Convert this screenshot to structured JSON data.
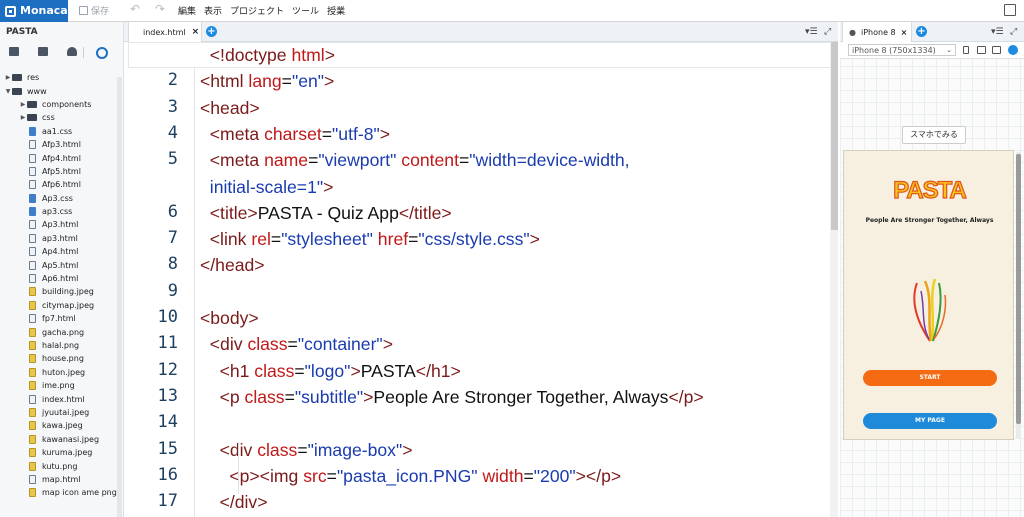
{
  "app": {
    "name": "Monaca",
    "save_label": "保存"
  },
  "menu": [
    "編集",
    "表示",
    "プロジェクト",
    "ツール",
    "授業"
  ],
  "sidebar": {
    "project": "PASTA",
    "tree": [
      {
        "label": "res",
        "type": "folder",
        "depth": 0,
        "arrow": "▶"
      },
      {
        "label": "www",
        "type": "folder",
        "depth": 0,
        "arrow": "▼"
      },
      {
        "label": "components",
        "type": "folder",
        "depth": 1,
        "arrow": "▶"
      },
      {
        "label": "css",
        "type": "folder",
        "depth": 1,
        "arrow": "▶"
      },
      {
        "label": "aa1.css",
        "type": "css",
        "depth": 1
      },
      {
        "label": "Afp3.html",
        "type": "file",
        "depth": 1
      },
      {
        "label": "Afp4.html",
        "type": "file",
        "depth": 1
      },
      {
        "label": "Afp5.html",
        "type": "file",
        "depth": 1
      },
      {
        "label": "Afp6.html",
        "type": "file",
        "depth": 1
      },
      {
        "label": "Ap3.css",
        "type": "css",
        "depth": 1
      },
      {
        "label": "ap3.css",
        "type": "css",
        "depth": 1
      },
      {
        "label": "Ap3.html",
        "type": "file",
        "depth": 1
      },
      {
        "label": "ap3.html",
        "type": "file",
        "depth": 1
      },
      {
        "label": "Ap4.html",
        "type": "file",
        "depth": 1
      },
      {
        "label": "Ap5.html",
        "type": "file",
        "depth": 1
      },
      {
        "label": "Ap6.html",
        "type": "file",
        "depth": 1
      },
      {
        "label": "building.jpeg",
        "type": "img",
        "depth": 1
      },
      {
        "label": "citymap.jpeg",
        "type": "img",
        "depth": 1
      },
      {
        "label": "fp7.html",
        "type": "file",
        "depth": 1
      },
      {
        "label": "gacha.png",
        "type": "img",
        "depth": 1
      },
      {
        "label": "halal.png",
        "type": "img",
        "depth": 1
      },
      {
        "label": "house.png",
        "type": "img",
        "depth": 1
      },
      {
        "label": "huton.jpeg",
        "type": "img",
        "depth": 1
      },
      {
        "label": "ime.png",
        "type": "img",
        "depth": 1
      },
      {
        "label": "index.html",
        "type": "file",
        "depth": 1
      },
      {
        "label": "jyuutai.jpeg",
        "type": "img",
        "depth": 1
      },
      {
        "label": "kawa.jpeg",
        "type": "img",
        "depth": 1
      },
      {
        "label": "kawanasi.jpeg",
        "type": "img",
        "depth": 1
      },
      {
        "label": "kuruma.jpeg",
        "type": "img",
        "depth": 1
      },
      {
        "label": "kutu.png",
        "type": "img",
        "depth": 1
      },
      {
        "label": "map.html",
        "type": "file",
        "depth": 1
      },
      {
        "label": "map icon ame png",
        "type": "img",
        "depth": 1
      }
    ]
  },
  "editor": {
    "tab_label": "index.html",
    "close_glyph": "×",
    "lines": [
      {
        "n": "1",
        "parts": [
          [
            "tx",
            "  "
          ],
          [
            "kt",
            "<!doctype "
          ],
          [
            "at",
            "html"
          ],
          [
            "kt",
            ">"
          ]
        ]
      },
      {
        "n": "2",
        "parts": [
          [
            "kt",
            "<html "
          ],
          [
            "at",
            "lang"
          ],
          [
            "tx",
            "="
          ],
          [
            "sv",
            "\"en\""
          ],
          [
            "kt",
            ">"
          ]
        ]
      },
      {
        "n": "3",
        "parts": [
          [
            "kt",
            "<head>"
          ]
        ]
      },
      {
        "n": "4",
        "parts": [
          [
            "tx",
            "  "
          ],
          [
            "kt",
            "<meta "
          ],
          [
            "at",
            "charset"
          ],
          [
            "tx",
            "="
          ],
          [
            "sv",
            "\"utf-8\""
          ],
          [
            "kt",
            ">"
          ]
        ]
      },
      {
        "n": "5",
        "parts": [
          [
            "tx",
            "  "
          ],
          [
            "kt",
            "<meta "
          ],
          [
            "at",
            "name"
          ],
          [
            "tx",
            "="
          ],
          [
            "sv",
            "\"viewport\""
          ],
          [
            "tx",
            " "
          ],
          [
            "at",
            "content"
          ],
          [
            "tx",
            "="
          ],
          [
            "sv",
            "\"width=device-width,"
          ]
        ]
      },
      {
        "n": "",
        "parts": [
          [
            "tx",
            "  "
          ],
          [
            "sv",
            "initial-scale=1\""
          ],
          [
            "kt",
            ">"
          ]
        ]
      },
      {
        "n": "6",
        "parts": [
          [
            "tx",
            "  "
          ],
          [
            "kt",
            "<title>"
          ],
          [
            "tx",
            "PASTA - Quiz App"
          ],
          [
            "kt",
            "</title>"
          ]
        ]
      },
      {
        "n": "7",
        "parts": [
          [
            "tx",
            "  "
          ],
          [
            "kt",
            "<link "
          ],
          [
            "at",
            "rel"
          ],
          [
            "tx",
            "="
          ],
          [
            "sv",
            "\"stylesheet\""
          ],
          [
            "tx",
            " "
          ],
          [
            "at",
            "href"
          ],
          [
            "tx",
            "="
          ],
          [
            "sv",
            "\"css/style.css\""
          ],
          [
            "kt",
            ">"
          ]
        ]
      },
      {
        "n": "8",
        "parts": [
          [
            "kt",
            "</head>"
          ]
        ]
      },
      {
        "n": "9",
        "parts": []
      },
      {
        "n": "10",
        "parts": [
          [
            "kt",
            "<body>"
          ]
        ]
      },
      {
        "n": "11",
        "parts": [
          [
            "tx",
            "  "
          ],
          [
            "kt",
            "<div "
          ],
          [
            "at",
            "class"
          ],
          [
            "tx",
            "="
          ],
          [
            "sv",
            "\"container\""
          ],
          [
            "kt",
            ">"
          ]
        ]
      },
      {
        "n": "12",
        "parts": [
          [
            "tx",
            "    "
          ],
          [
            "kt",
            "<h1 "
          ],
          [
            "at",
            "class"
          ],
          [
            "tx",
            "="
          ],
          [
            "sv",
            "\"logo\""
          ],
          [
            "kt",
            ">"
          ],
          [
            "tx",
            "PASTA"
          ],
          [
            "kt",
            "</h1>"
          ]
        ]
      },
      {
        "n": "13",
        "parts": [
          [
            "tx",
            "    "
          ],
          [
            "kt",
            "<p "
          ],
          [
            "at",
            "class"
          ],
          [
            "tx",
            "="
          ],
          [
            "sv",
            "\"subtitle\""
          ],
          [
            "kt",
            ">"
          ],
          [
            "tx",
            "People Are Stronger Together, Always"
          ],
          [
            "kt",
            "</p>"
          ]
        ]
      },
      {
        "n": "14",
        "parts": []
      },
      {
        "n": "15",
        "parts": [
          [
            "tx",
            "    "
          ],
          [
            "kt",
            "<div "
          ],
          [
            "at",
            "class"
          ],
          [
            "tx",
            "="
          ],
          [
            "sv",
            "\"image-box\""
          ],
          [
            "kt",
            ">"
          ]
        ]
      },
      {
        "n": "16",
        "parts": [
          [
            "tx",
            "      "
          ],
          [
            "kt",
            "<p><img "
          ],
          [
            "at",
            "src"
          ],
          [
            "tx",
            "="
          ],
          [
            "sv",
            "\"pasta_icon.PNG\""
          ],
          [
            "tx",
            " "
          ],
          [
            "at",
            "width"
          ],
          [
            "tx",
            "="
          ],
          [
            "sv",
            "\"200\""
          ],
          [
            "kt",
            "></p>"
          ]
        ]
      },
      {
        "n": "17",
        "parts": [
          [
            "tx",
            "    "
          ],
          [
            "kt",
            "</div>"
          ]
        ]
      }
    ]
  },
  "preview": {
    "tab_label": "iPhone 8",
    "device_select": "iPhone 8 (750x1334)",
    "smartphone_button": "スマホでみる",
    "phone": {
      "title": "PASTA",
      "subtitle": "People Are Stronger Together, Always",
      "start_label": "START",
      "mypage_label": "MY PAGE"
    }
  },
  "colors": {
    "brand": "#1d6fc2",
    "start": "#f56b14",
    "mypage": "#1f8ad9",
    "logo_fill": "#f7c21b",
    "tag": "#7a1a1a",
    "attr": "#c01818",
    "string": "#1a3bb0"
  }
}
